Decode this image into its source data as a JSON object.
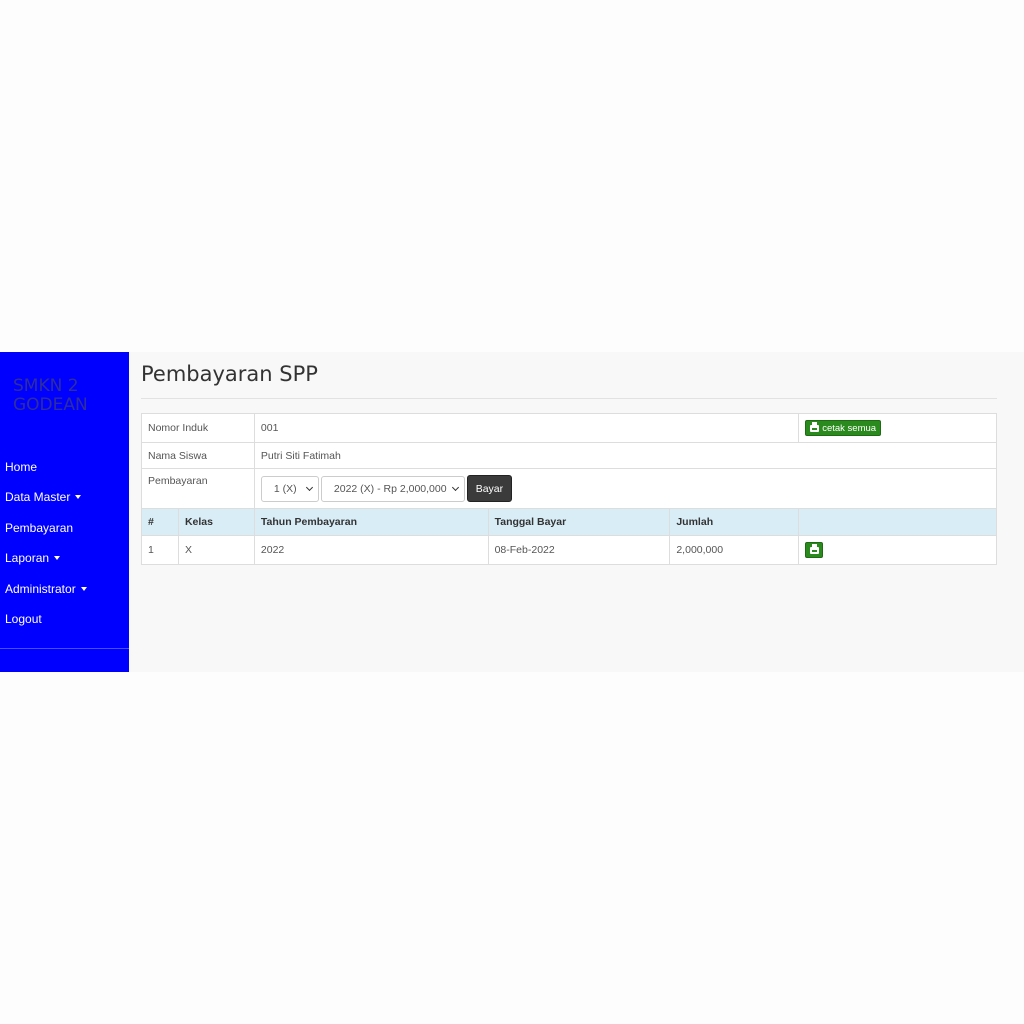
{
  "sidebar": {
    "brand": "SMKN 2 GODEAN",
    "items": [
      {
        "label": "Home",
        "dropdown": false
      },
      {
        "label": "Data Master",
        "dropdown": true
      },
      {
        "label": "Pembayaran",
        "dropdown": false
      },
      {
        "label": "Laporan",
        "dropdown": true
      },
      {
        "label": "Administrator",
        "dropdown": true
      },
      {
        "label": "Logout",
        "dropdown": false
      }
    ]
  },
  "page": {
    "title": "Pembayaran SPP"
  },
  "student": {
    "induk_label": "Nomor Induk",
    "induk_value": "001",
    "nama_label": "Nama Siswa",
    "nama_value": "Putri Siti Fatimah",
    "pembayaran_label": "Pembayaran",
    "cetak_semua_label": "cetak semua"
  },
  "form": {
    "kelas_selected": "1 (X)",
    "tahun_selected": "2022 (X) - Rp 2,000,000",
    "bayar_label": "Bayar"
  },
  "payments": {
    "headers": [
      "#",
      "Kelas",
      "Tahun Pembayaran",
      "Tanggal Bayar",
      "Jumlah",
      ""
    ],
    "rows": [
      {
        "no": "1",
        "kelas": "X",
        "tahun": "2022",
        "tanggal": "08-Feb-2022",
        "jumlah": "2,000,000"
      }
    ]
  },
  "colors": {
    "sidebar_bg": "#0000ff",
    "print_button": "#2b8a1e",
    "table_header": "#d9edf7",
    "bayar_button": "#3b3b3b"
  },
  "icons": {
    "print": "printer-icon",
    "dropdown": "caret-down-icon"
  }
}
